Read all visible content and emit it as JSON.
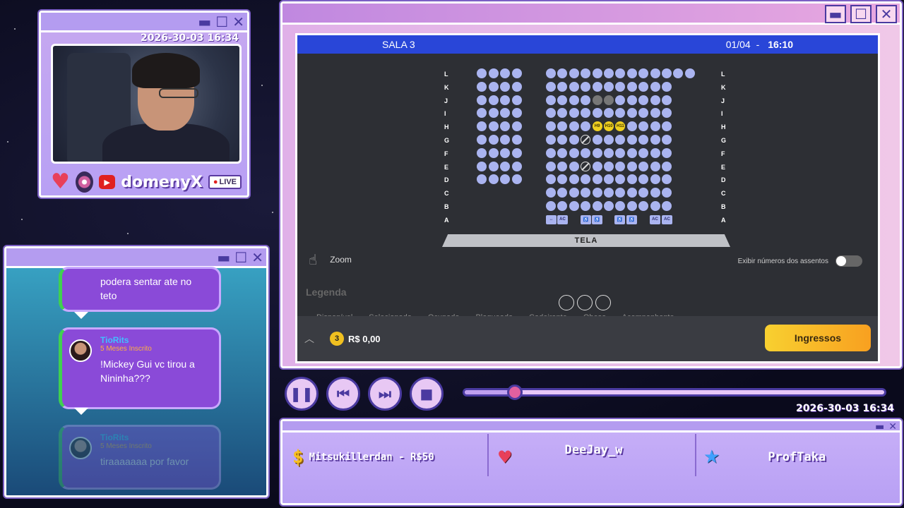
{
  "webcam": {
    "timestamp": "2026-30-03 16:34",
    "channel": "domenyX",
    "live_label": "LIVE",
    "heart_icon": "heart-icon",
    "disc_icon": "vinyl-disc-icon",
    "youtube_icon": "youtube-icon"
  },
  "chat": {
    "messages": [
      {
        "text": "podera sentar ate no teto"
      },
      {
        "user": "TioRits",
        "sub": "5 Meses Inscrito",
        "text": "!Mickey Gui vc tirou a Nininha???"
      },
      {
        "user": "TioRits",
        "sub": "5 Meses Inscrito",
        "text": "tiraaaaaaa por favor"
      }
    ]
  },
  "cinema": {
    "room": "SALA 3",
    "date": "01/04",
    "separator": "-",
    "time": "16:10",
    "rows": [
      "L",
      "K",
      "J",
      "I",
      "H",
      "G",
      "F",
      "E",
      "D",
      "C",
      "B",
      "A"
    ],
    "selected_seats": [
      "H9",
      "H10",
      "H11"
    ],
    "special_seats": [
      "↔",
      "AC",
      "♿",
      "♿",
      "♿",
      "♿",
      "AC",
      "AC"
    ],
    "screen_label": "TELA",
    "zoom_label": "Zoom",
    "show_numbers_label": "Exibir números dos assentos",
    "legend_title": "Legenda",
    "legend_items": [
      "Disponível",
      "Selecionado",
      "Ocupado",
      "Bloqueado",
      "Cadeirante",
      "Obeso",
      "Acompanhante"
    ],
    "ticket_count": "3",
    "total_price": "R$ 0,00",
    "buy_button": "Ingressos"
  },
  "player": {
    "timestamp": "2026-30-03 16:34",
    "progress": 0.12,
    "pause_icon": "pause-icon",
    "prev_icon": "skip-back-icon",
    "next_icon": "skip-forward-icon",
    "stop_icon": "stop-icon"
  },
  "alerts": {
    "donation": "Mitsukillerdan - R$50",
    "follower": "DeeJay_w",
    "subscriber": "ProfTaka"
  },
  "colors": {
    "seat_available": "#aab4f0",
    "seat_selected": "#f0d020",
    "room_bar": "#2946d8",
    "buy_button": "#f8b020"
  }
}
